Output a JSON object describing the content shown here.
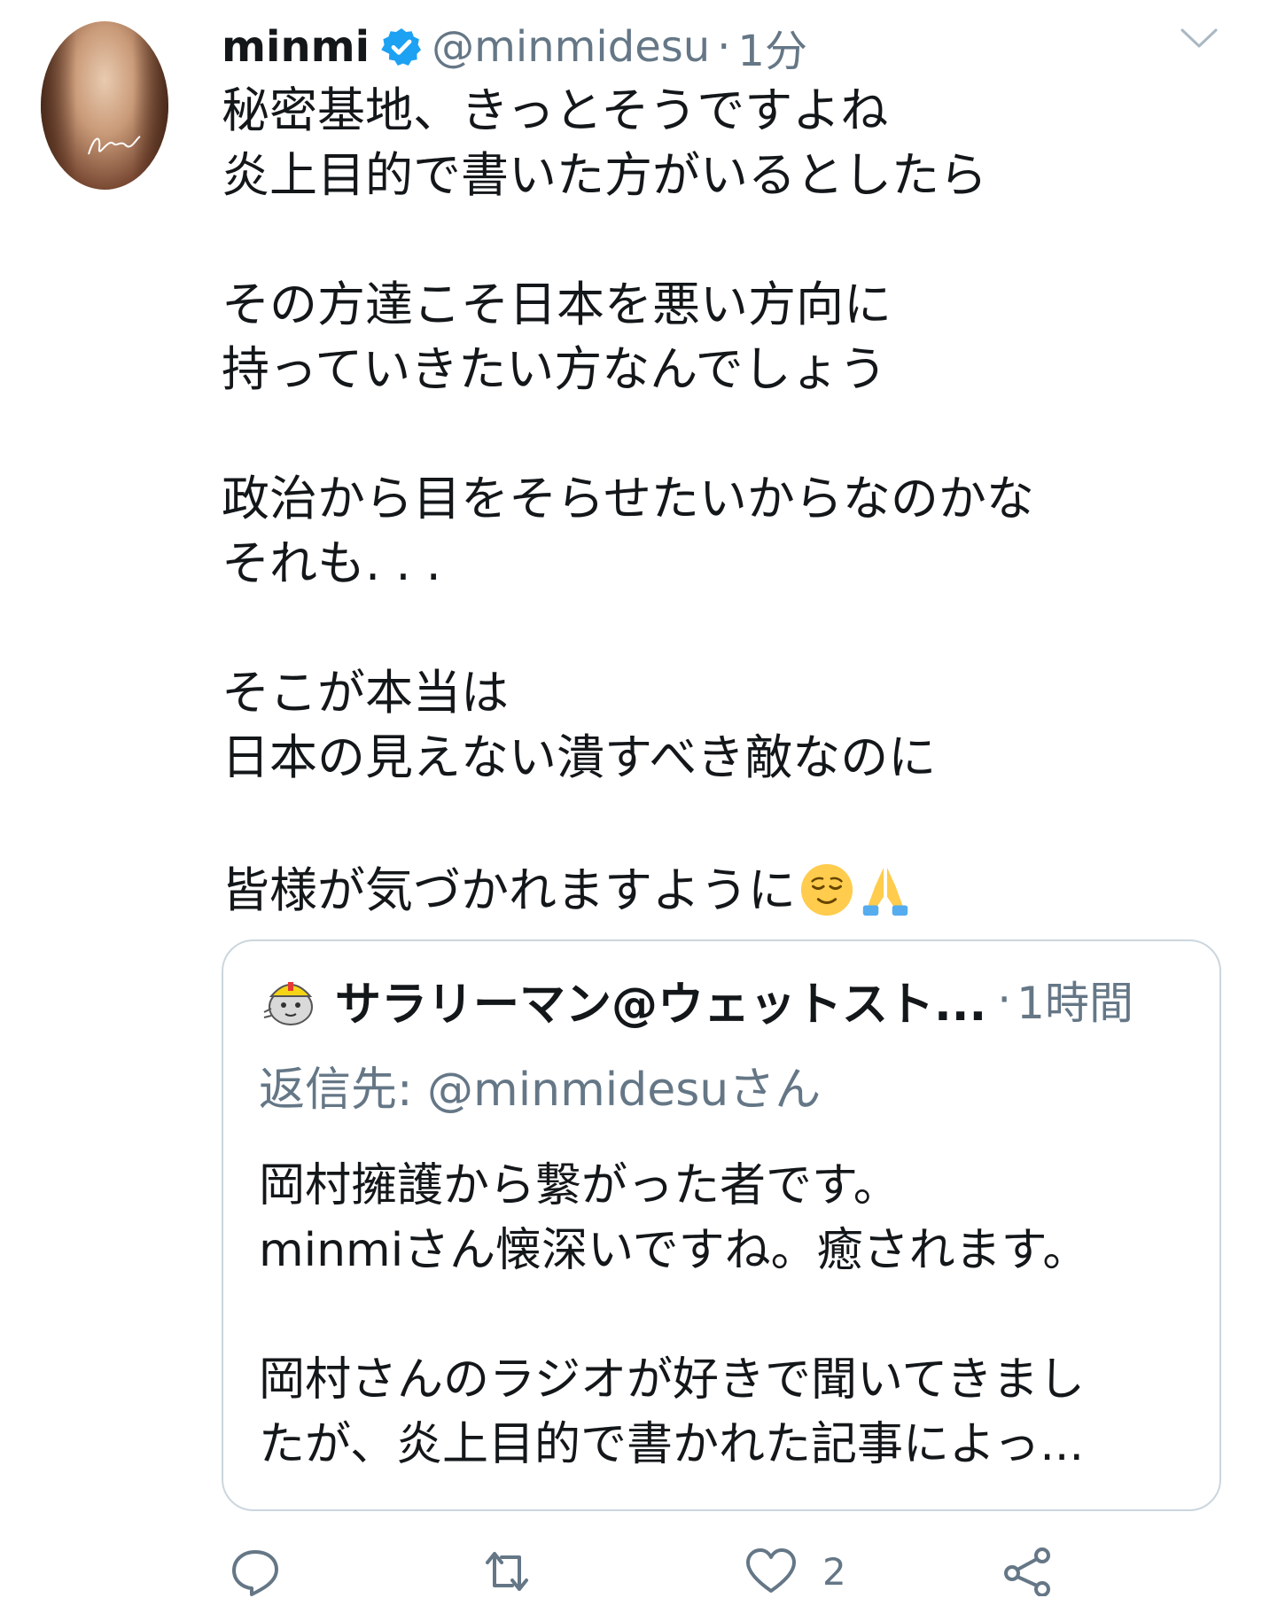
{
  "tweet": {
    "name": "minmi",
    "handle": "@minmidesu",
    "separator": "·",
    "time": "1分",
    "text": "秘密基地、きっとそうですよね\n炎上目的で書いた方がいるとしたら\n\nその方達こそ日本を悪い方向に\n持っていきたい方なんでしょう\n\n政治から目をそらせたいからなのかな\nそれも. . .\n\nそこが本当は\n日本の見えない潰すべき敵なのに\n\n",
    "last_line": "皆様が気づかれますように",
    "emojis": [
      "relieved-face",
      "folded-hands"
    ]
  },
  "quote": {
    "name": "サラリーマン@ウェットスト...",
    "separator": "·",
    "time": "1時間",
    "reply_to": "返信先: @minmidesuさん",
    "text": "岡村擁護から繋がった者です。\nminmiさん懐深いですね。癒されます。\n\n岡村さんのラジオが好きで聞いてきまし\nたが、炎上目的で書かれた記事によっ..."
  },
  "actions": {
    "reply": "",
    "retweet": "",
    "like_count": "2",
    "share": ""
  },
  "colors": {
    "text": "#14171a",
    "secondary": "#657786",
    "verified": "#1da1f2",
    "border": "#ccd6dd"
  }
}
